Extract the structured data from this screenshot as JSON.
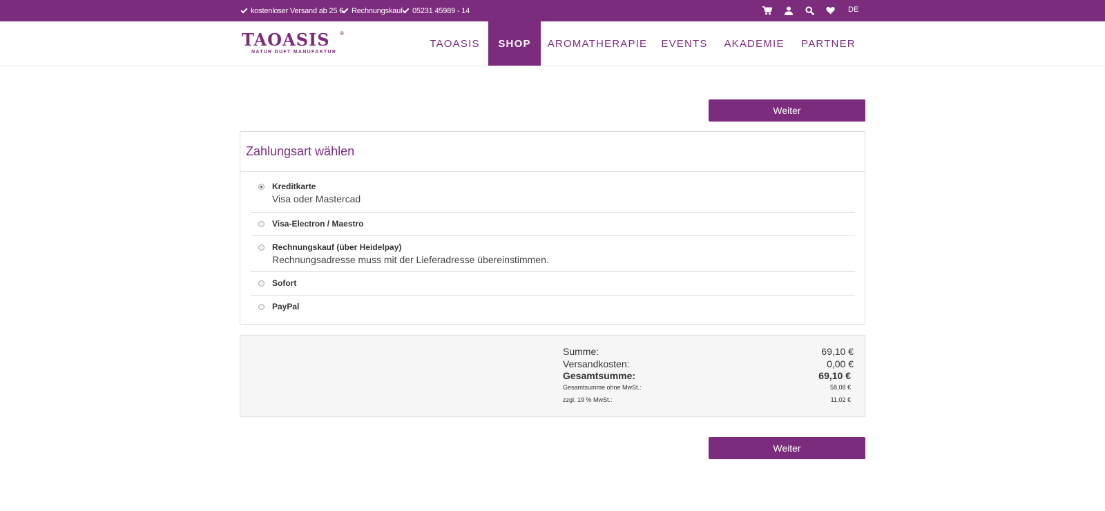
{
  "topbar": {
    "usps": [
      "kostenloser Versand ab 25 €",
      "Rechnungskauf",
      "05231 45989 - 14"
    ],
    "icons": [
      "cart-icon",
      "user-icon",
      "search-icon",
      "heart-icon"
    ],
    "language": "DE"
  },
  "header": {
    "logo_main": "TAOASIS",
    "logo_reg": "®",
    "logo_sub": "NATUR DUFT MANUFAKTUR",
    "nav": [
      "TAOASIS",
      "SHOP",
      "AROMATHERAPIE",
      "EVENTS",
      "AKADEMIE",
      "PARTNER"
    ],
    "active_nav": "SHOP"
  },
  "buttons": {
    "weiter_top": "Weiter",
    "weiter_bottom": "Weiter"
  },
  "payment": {
    "title": "Zahlungsart wählen",
    "options": [
      {
        "label": "Kreditkarte",
        "description": "Visa oder Mastercad",
        "selected": true
      },
      {
        "label": "Visa-Electron / Maestro",
        "description": "",
        "selected": false
      },
      {
        "label": "Rechnungskauf (über Heidelpay)",
        "description": "Rechnungsadresse muss mit der Lieferadresse übereinstimmen.",
        "selected": false
      },
      {
        "label": "Sofort",
        "description": "",
        "selected": false
      },
      {
        "label": "PayPal",
        "description": "",
        "selected": false
      }
    ]
  },
  "summary": {
    "rows": [
      {
        "label": "Summe:",
        "value": "69,10 €"
      },
      {
        "label": "Versandkosten:",
        "value": "0,00 €"
      },
      {
        "label": "Gesamtsumme:",
        "value": "69,10 €"
      },
      {
        "label": "Gesamtsumme ohne MwSt.:",
        "value": "58,08 €"
      },
      {
        "label": "zzgl. 19 % MwSt.:",
        "value": "11,02 €"
      }
    ]
  },
  "colors": {
    "brand": "#7b2c7d",
    "summary_bg": "#f6f6f6"
  }
}
